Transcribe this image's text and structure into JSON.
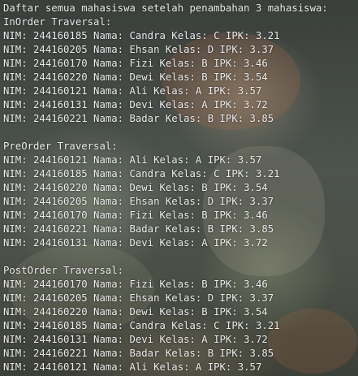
{
  "terminal": {
    "lines": [
      "Daftar semua mahasiswa setelah penambahan 3 mahasiswa:",
      "InOrder Traversal:",
      "NIM: 244160185 Nama: Candra Kelas: C IPK: 3.21",
      "NIM: 244160205 Nama: Ehsan Kelas: D IPK: 3.37",
      "NIM: 244160170 Nama: Fizi Kelas: B IPK: 3.46",
      "NIM: 244160220 Nama: Dewi Kelas: B IPK: 3.54",
      "NIM: 244160121 Nama: Ali Kelas: A IPK: 3.57",
      "NIM: 244160131 Nama: Devi Kelas: A IPK: 3.72",
      "NIM: 244160221 Nama: Badar Kelas: B IPK: 3.85",
      "",
      "PreOrder Traversal:",
      "NIM: 244160121 Nama: Ali Kelas: A IPK: 3.57",
      "NIM: 244160185 Nama: Candra Kelas: C IPK: 3.21",
      "NIM: 244160220 Nama: Dewi Kelas: B IPK: 3.54",
      "NIM: 244160205 Nama: Ehsan Kelas: D IPK: 3.37",
      "NIM: 244160170 Nama: Fizi Kelas: B IPK: 3.46",
      "NIM: 244160221 Nama: Badar Kelas: B IPK: 3.85",
      "NIM: 244160131 Nama: Devi Kelas: A IPK: 3.72",
      "",
      "PostOrder Traversal:",
      "NIM: 244160170 Nama: Fizi Kelas: B IPK: 3.46",
      "NIM: 244160205 Nama: Ehsan Kelas: D IPK: 3.37",
      "NIM: 244160220 Nama: Dewi Kelas: B IPK: 3.54",
      "NIM: 244160185 Nama: Candra Kelas: C IPK: 3.21",
      "NIM: 244160131 Nama: Devi Kelas: A IPK: 3.72",
      "NIM: 244160221 Nama: Badar Kelas: B IPK: 3.85",
      "NIM: 244160121 Nama: Ali Kelas: A IPK: 3.57"
    ],
    "text_color": "#ececec"
  }
}
